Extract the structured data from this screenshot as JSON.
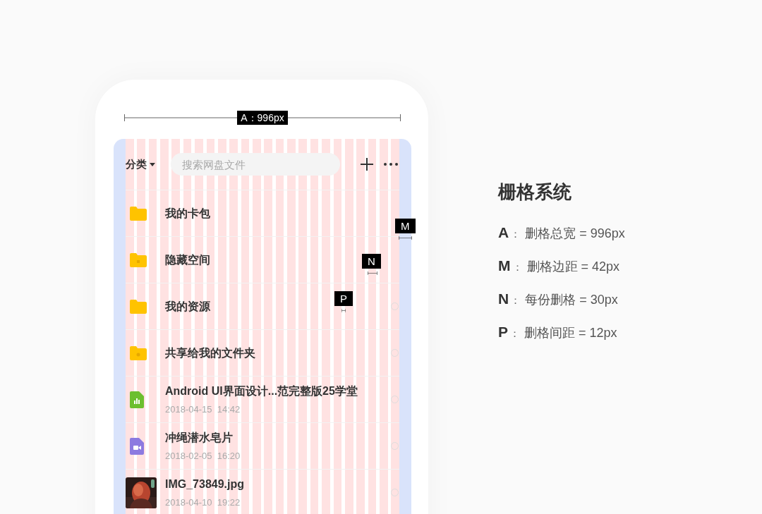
{
  "phone": {
    "toolbar": {
      "category": "分类",
      "search_placeholder": "搜索网盘文件"
    },
    "rows": [
      {
        "kind": "folder",
        "name": "我的卡包",
        "selectable": false
      },
      {
        "kind": "hidden",
        "name": "隐藏空间",
        "selectable": false
      },
      {
        "kind": "folder",
        "name": "我的资源",
        "selectable": true
      },
      {
        "kind": "shared",
        "name": "共享给我的文件夹",
        "selectable": true
      },
      {
        "kind": "sheet",
        "name": "Android UI界面设计...范完整版25学堂",
        "date": "2018-04-15  14:42",
        "selectable": true
      },
      {
        "kind": "video",
        "name": "冲绳潜水皂片",
        "date": "2018-02-05  16:20",
        "selectable": true
      },
      {
        "kind": "picture",
        "name": "IMG_73849.jpg",
        "date": "2018-04-10  19:22",
        "selectable": true
      }
    ]
  },
  "annotations": [
    {
      "kind": "total-width",
      "label": "A：996px"
    },
    {
      "kind": "margin",
      "label": "M"
    },
    {
      "kind": "column",
      "label": "N"
    },
    {
      "kind": "gutter",
      "label": "P"
    }
  ],
  "spec": {
    "title": "栅格系统",
    "items": [
      {
        "key": "A",
        "separator": "：",
        "text": "删格总宽 = 996px"
      },
      {
        "key": "M",
        "separator": "：",
        "text": "删格边距 = 42px"
      },
      {
        "key": "N",
        "separator": "：",
        "text": "每份删格 = 30px"
      },
      {
        "key": "P",
        "separator": "：",
        "text": "删格间距 = 12px"
      }
    ]
  }
}
